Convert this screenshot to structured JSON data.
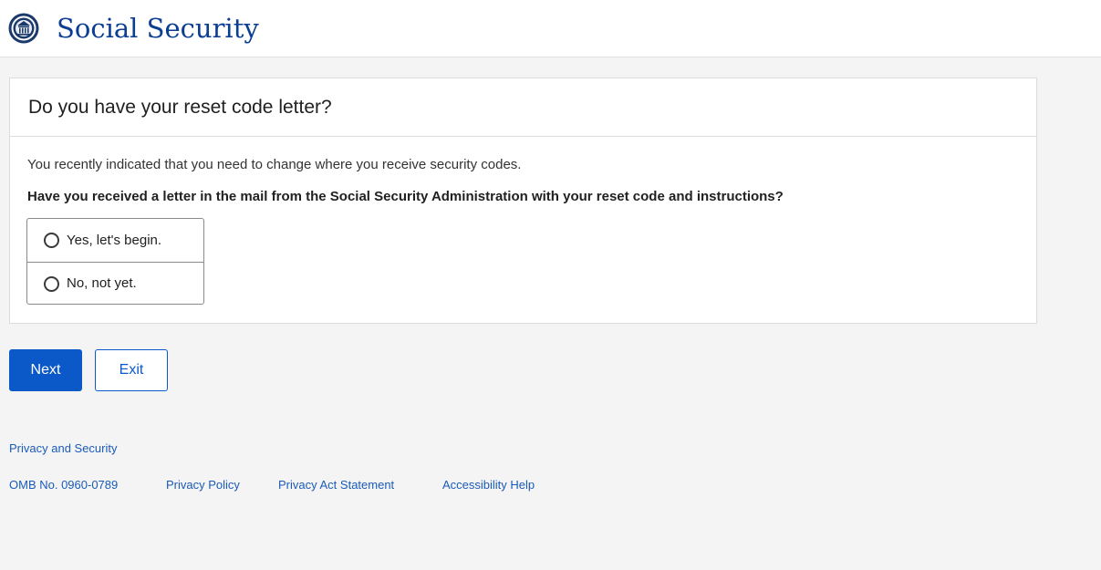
{
  "header": {
    "logo_icon": "ssa-seal-icon",
    "brand": "Social Security",
    "brand_color": "#0b3d91"
  },
  "card": {
    "title": "Do you have your reset code letter?",
    "intro": "You recently indicated that you need to change where you receive security codes.",
    "question": "Have you received a letter in the mail from the Social Security Administration with your reset code and instructions?",
    "options": [
      {
        "label": "Yes, let's begin.",
        "selected": false
      },
      {
        "label": "No, not yet.",
        "selected": false
      }
    ]
  },
  "actions": {
    "next_label": "Next",
    "exit_label": "Exit",
    "accent_color": "#0b59c9"
  },
  "footer": {
    "privacy_security": "Privacy and Security",
    "omb": "OMB No. 0960-0789",
    "privacy_policy": "Privacy Policy",
    "privacy_act": "Privacy Act Statement",
    "accessibility": "Accessibility Help"
  }
}
